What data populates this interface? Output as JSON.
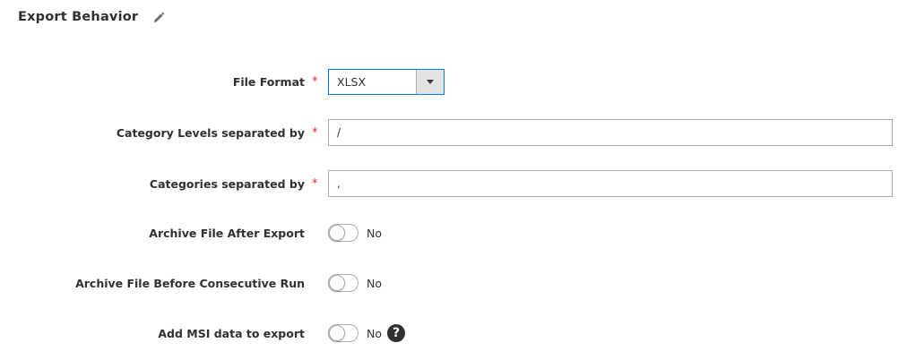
{
  "section": {
    "title": "Export Behavior"
  },
  "fields": {
    "file_format": {
      "label": "File Format",
      "required_mark": "*",
      "value": "XLSX"
    },
    "category_levels": {
      "label": "Category Levels separated by",
      "required_mark": "*",
      "value": "/"
    },
    "categories_separator": {
      "label": "Categories separated by",
      "required_mark": "*",
      "value": ","
    },
    "archive_after_export": {
      "label": "Archive File After Export",
      "state": "No"
    },
    "archive_before_run": {
      "label": "Archive File Before Consecutive Run",
      "state": "No"
    },
    "msi_data": {
      "label": "Add MSI data to export",
      "state": "No",
      "help_glyph": "?"
    }
  },
  "colors": {
    "required": "#e22626",
    "select_focus_border": "#007bdb",
    "input_border": "#adadad",
    "text": "#303030"
  },
  "icons": {
    "edit": "pencil-icon",
    "dropdown": "caret-down-icon",
    "help": "question-circle-icon"
  }
}
